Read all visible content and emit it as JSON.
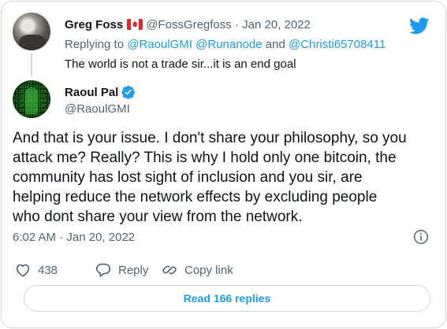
{
  "parent_tweet": {
    "name": "Greg Foss",
    "flag_icon": "canada-flag-icon",
    "handle": "@FossGregfoss",
    "separator": "·",
    "date": "Jan 20, 2022",
    "replying_prefix": "Replying to",
    "mention_1": "@RaoulGMI",
    "mention_2": "@Runanode",
    "and_word": "and",
    "mention_3": "@Christi65708411",
    "text": "The world is not a trade sir...it is an end goal"
  },
  "main_tweet": {
    "name": "Raoul Pal",
    "handle": "@RaoulGMI",
    "text": "And that is your issue. I don't share your philosophy, so you\nattack me? Really? This is why I hold only one bitcoin, the\ncommunity has lost sight of inclusion and you sir, are\nhelping reduce the network effects by excluding people\nwho dont share your view from the network.",
    "time": "6:02 AM",
    "separator": "·",
    "date": "Jan 20, 2022"
  },
  "actions": {
    "likes": "438",
    "reply_label": "Reply",
    "copy_link_label": "Copy link"
  },
  "read_replies_label": "Read 166 replies",
  "colors": {
    "accent": "#1d9bf0",
    "secondary_text": "#536471",
    "border": "#cfd9de"
  }
}
